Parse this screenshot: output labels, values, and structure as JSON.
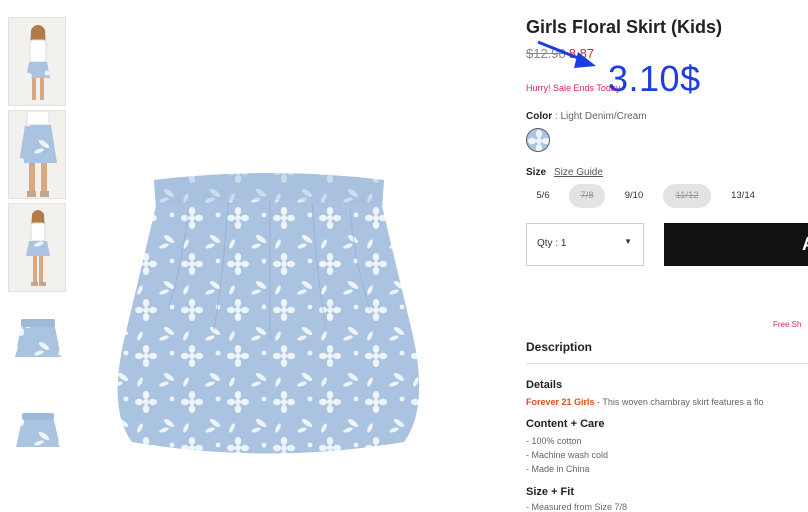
{
  "product": {
    "title": "Girls Floral Skirt (Kids)",
    "old_price": "$12.90",
    "sale_price": "8.87",
    "hurry": "Hurry! Sale Ends Today"
  },
  "annotation": {
    "price_text": "3.10$",
    "color": "#1a3ee0"
  },
  "color": {
    "label": "Color",
    "value": "Light Denim/Cream"
  },
  "size": {
    "label": "Size",
    "guide_label": "Size Guide",
    "options": [
      {
        "label": "5/6",
        "available": true
      },
      {
        "label": "7/8",
        "available": false
      },
      {
        "label": "9/10",
        "available": true
      },
      {
        "label": "11/12",
        "available": false
      },
      {
        "label": "13/14",
        "available": true
      }
    ]
  },
  "qty": {
    "label": "Qty : 1"
  },
  "add_button": {
    "label": "A"
  },
  "shipping": {
    "text": "Free Sh"
  },
  "description": {
    "heading": "Description",
    "details_heading": "Details",
    "brand": "Forever 21 Girls",
    "details_text": " - This woven chambray skirt features a flo",
    "care_heading": "Content + Care",
    "care_lines": [
      "- 100% cotton",
      "- Machine wash cold",
      "- Made in China"
    ],
    "fit_heading": "Size + Fit",
    "fit_line": "- Measured from Size 7/8"
  },
  "thumbnails": [
    {
      "name": "thumbnail-model-front"
    },
    {
      "name": "thumbnail-model-detail"
    },
    {
      "name": "thumbnail-model-full"
    },
    {
      "name": "thumbnail-skirt-front"
    },
    {
      "name": "thumbnail-skirt-back"
    }
  ],
  "colors": {
    "sale": "#d2232a",
    "hurry": "#e0245e",
    "brand": "#e04a1e",
    "button": "#111111",
    "denim": "#a9c3e0"
  }
}
